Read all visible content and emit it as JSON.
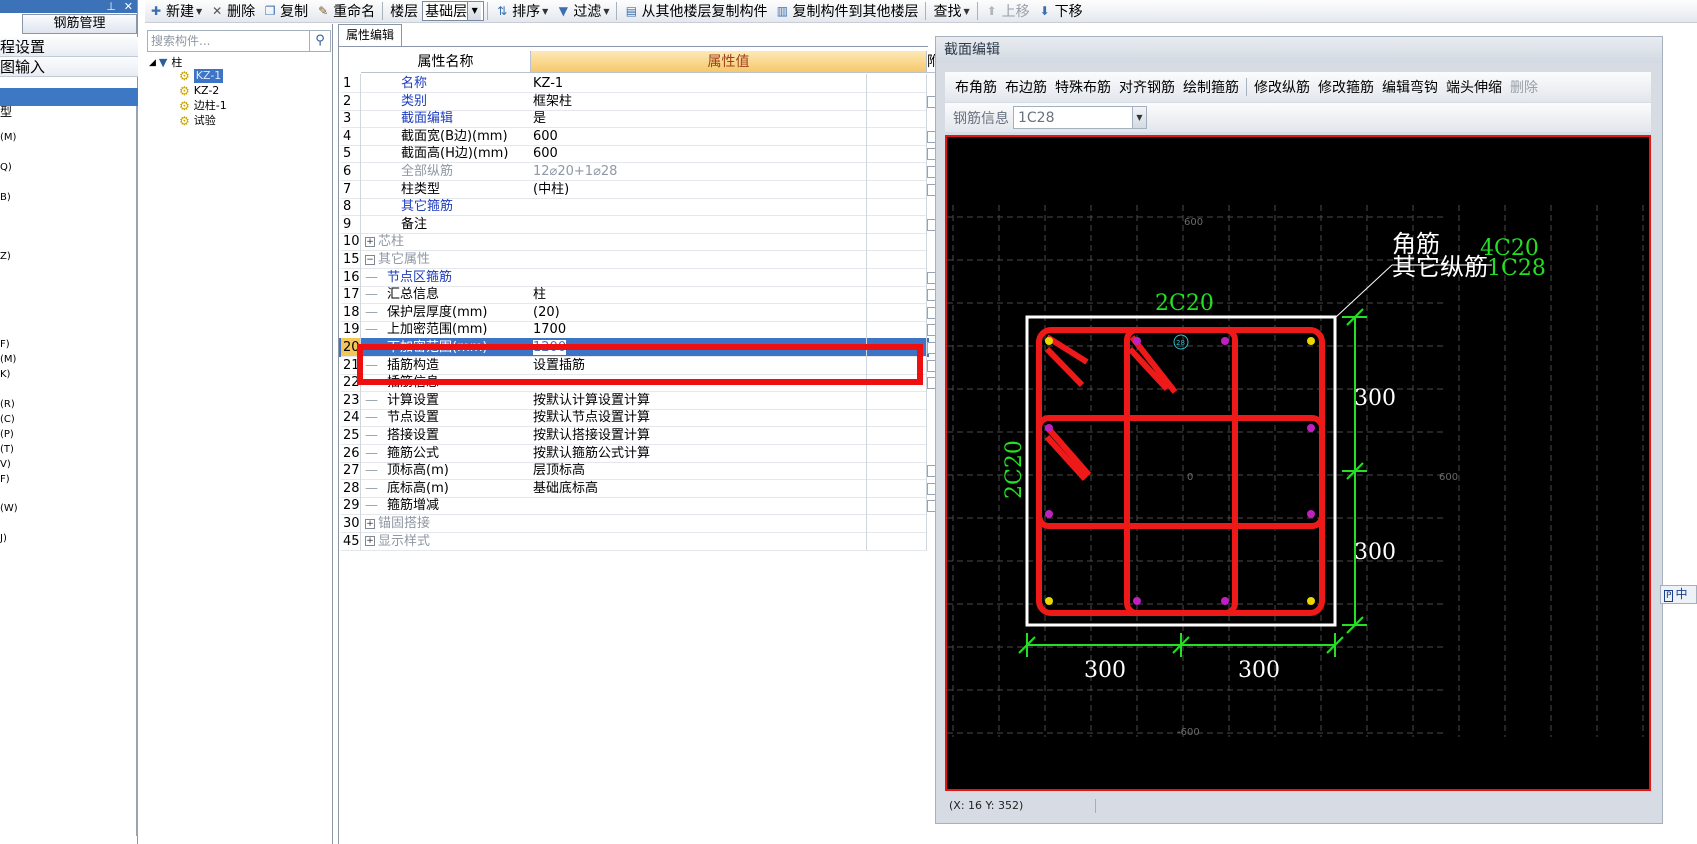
{
  "left_panel": {
    "title_icons": [
      "pin-icon",
      "close-icon"
    ],
    "pin_glyph": "⊥",
    "close_glyph": "✕",
    "rebar_button": "钢筋管理",
    "items": [
      "程设置",
      "图输入"
    ],
    "list_fragments": [
      "型",
      "(M)",
      "Q)",
      "B)",
      "Z)",
      "F)",
      "(M)",
      "K)",
      "(R)",
      "(C)",
      "(P)",
      "(T)",
      "V)",
      "F)",
      "(W)",
      "J)"
    ]
  },
  "toolbar": {
    "new": "新建",
    "delete": "删除",
    "copy": "复制",
    "rename": "重命名",
    "floor_label": "楼层",
    "floor_value": "基础层",
    "sort": "排序",
    "filter": "过滤",
    "copy_from_floor": "从其他楼层复制构件",
    "copy_to_floor": "复制构件到其他楼层",
    "find": "查找",
    "move_up": "上移",
    "move_down": "下移"
  },
  "tree": {
    "search_placeholder": "搜索构件...",
    "root": "柱",
    "children": [
      "KZ-1",
      "KZ-2",
      "边柱-1",
      "试验"
    ]
  },
  "properties": {
    "tab": "属性编辑",
    "col_name": "属性名称",
    "col_value": "属性值",
    "col_extra": "附",
    "rows": [
      {
        "num": "1",
        "name": "名称",
        "value": "KZ-1",
        "style": "blue",
        "indent": 0,
        "check": false
      },
      {
        "num": "2",
        "name": "类别",
        "value": "框架柱",
        "style": "blue",
        "indent": 0,
        "check": true
      },
      {
        "num": "3",
        "name": "截面编辑",
        "value": "是",
        "style": "blue",
        "indent": 0,
        "check": false
      },
      {
        "num": "4",
        "name": "截面宽(B边)(mm)",
        "value": "600",
        "style": "normal",
        "indent": 0,
        "check": true
      },
      {
        "num": "5",
        "name": "截面高(H边)(mm)",
        "value": "600",
        "style": "normal",
        "indent": 0,
        "check": true
      },
      {
        "num": "6",
        "name": "全部纵筋",
        "value": "12⌀20+1⌀28",
        "style": "gray",
        "indent": 0,
        "check": true
      },
      {
        "num": "7",
        "name": "柱类型",
        "value": "(中柱)",
        "style": "normal",
        "indent": 0,
        "check": true
      },
      {
        "num": "8",
        "name": "其它箍筋",
        "value": "",
        "style": "blue",
        "indent": 0,
        "check": false
      },
      {
        "num": "9",
        "name": "备注",
        "value": "",
        "style": "normal",
        "indent": 0,
        "check": true
      },
      {
        "num": "10",
        "name": "芯柱",
        "value": "",
        "style": "gray",
        "indent": 0,
        "expander": "+",
        "check": false
      },
      {
        "num": "15",
        "name": "其它属性",
        "value": "",
        "style": "gray",
        "indent": 0,
        "expander": "−",
        "check": false
      },
      {
        "num": "16",
        "name": "节点区箍筋",
        "value": "",
        "style": "blue",
        "indent": 1,
        "check": true
      },
      {
        "num": "17",
        "name": "汇总信息",
        "value": "柱",
        "style": "normal",
        "indent": 1,
        "check": true
      },
      {
        "num": "18",
        "name": "保护层厚度(mm)",
        "value": "(20)",
        "style": "normal",
        "indent": 1,
        "check": true
      },
      {
        "num": "19",
        "name": "上加密范围(mm)",
        "value": "1700",
        "style": "normal",
        "indent": 1,
        "check": true
      },
      {
        "num": "20",
        "name": "下加密范围(mm)",
        "value": "1200",
        "style": "selected",
        "indent": 1,
        "check": true
      },
      {
        "num": "21",
        "name": "插筋构造",
        "value": "设置插筋",
        "style": "normal",
        "indent": 1,
        "check": true
      },
      {
        "num": "22",
        "name": "插筋信息",
        "value": "",
        "style": "normal",
        "indent": 1,
        "check": true
      },
      {
        "num": "23",
        "name": "计算设置",
        "value": "按默认计算设置计算",
        "style": "normal",
        "indent": 1,
        "check": false
      },
      {
        "num": "24",
        "name": "节点设置",
        "value": "按默认节点设置计算",
        "style": "normal",
        "indent": 1,
        "check": false
      },
      {
        "num": "25",
        "name": "搭接设置",
        "value": "按默认搭接设置计算",
        "style": "normal",
        "indent": 1,
        "check": false
      },
      {
        "num": "26",
        "name": "箍筋公式",
        "value": "按默认箍筋公式计算",
        "style": "normal",
        "indent": 1,
        "check": false
      },
      {
        "num": "27",
        "name": "顶标高(m)",
        "value": "层顶标高",
        "style": "normal",
        "indent": 1,
        "check": true
      },
      {
        "num": "28",
        "name": "底标高(m)",
        "value": "基础底标高",
        "style": "normal",
        "indent": 1,
        "check": true
      },
      {
        "num": "29",
        "name": "箍筋增减",
        "value": "",
        "style": "normal",
        "indent": 1,
        "check": true
      },
      {
        "num": "30",
        "name": "锚固搭接",
        "value": "",
        "style": "gray",
        "indent": 0,
        "expander": "+",
        "check": false
      },
      {
        "num": "45",
        "name": "显示样式",
        "value": "",
        "style": "gray",
        "indent": 0,
        "expander": "+",
        "check": false
      }
    ]
  },
  "section_editor": {
    "title": "截面编辑",
    "tools": [
      "布角筋",
      "布边筋",
      "特殊布筋",
      "对齐钢筋",
      "绘制箍筋",
      "修改纵筋",
      "修改箍筋",
      "编辑弯钩",
      "端头伸缩",
      "删除"
    ],
    "rebar_info_label": "钢筋信息",
    "rebar_info_value": "1C28",
    "status": "(X: 16 Y: 352)",
    "drawing": {
      "label_corner": "角筋",
      "label_other": "其它纵筋",
      "label_4c20": "4C20",
      "label_1c28": "1C28",
      "label_top": "2C20",
      "label_left": "2C20",
      "dim_right_top": "300",
      "dim_right_bottom": "300",
      "dim_bottom_left": "300",
      "dim_bottom_right": "300",
      "axis_top": "600",
      "axis_right": "600",
      "axis_bottom": "-600",
      "axis_center": "0",
      "marker": "28",
      "colors": {
        "rebar": "#ee1a1a",
        "dimension": "#22e022",
        "outline": "#ffffff",
        "grid": "#4a4a4a"
      }
    }
  },
  "edge_button": "中"
}
